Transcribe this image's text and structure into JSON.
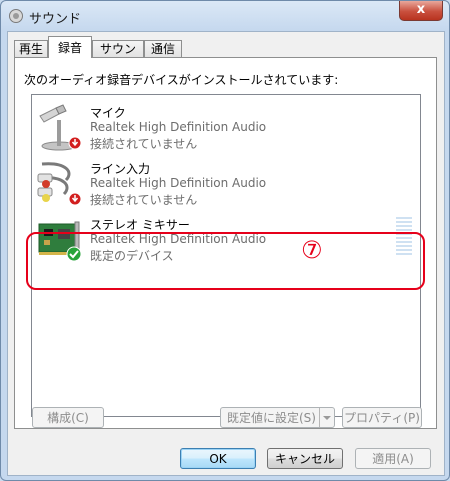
{
  "window": {
    "title": "サウンド",
    "close_glyph": "x"
  },
  "tabs": [
    {
      "label": "再生"
    },
    {
      "label": "録音"
    },
    {
      "label": "サウンド"
    },
    {
      "label": "通信"
    }
  ],
  "panel": {
    "instruction": "次のオーディオ録音デバイスがインストールされています:"
  },
  "devices": [
    {
      "name": "マイク",
      "driver": "Realtek High Definition Audio",
      "status": "接続されていません",
      "icon": "microphone-icon",
      "badge": "disconnected-badge"
    },
    {
      "name": "ライン入力",
      "driver": "Realtek High Definition Audio",
      "status": "接続されていません",
      "icon": "rca-cable-icon",
      "badge": "disconnected-badge"
    },
    {
      "name": "ステレオ ミキサー",
      "driver": "Realtek High Definition Audio",
      "status": "既定のデバイス",
      "icon": "sound-card-icon",
      "badge": "default-check-badge"
    }
  ],
  "annotation": {
    "marker": "⑦",
    "color": "#e6001a"
  },
  "buttons": {
    "configure": "構成(C)",
    "set_default": "既定値に設定(S)",
    "properties": "プロパティ(P)",
    "ok": "OK",
    "cancel": "キャンセル",
    "apply": "適用(A)"
  }
}
